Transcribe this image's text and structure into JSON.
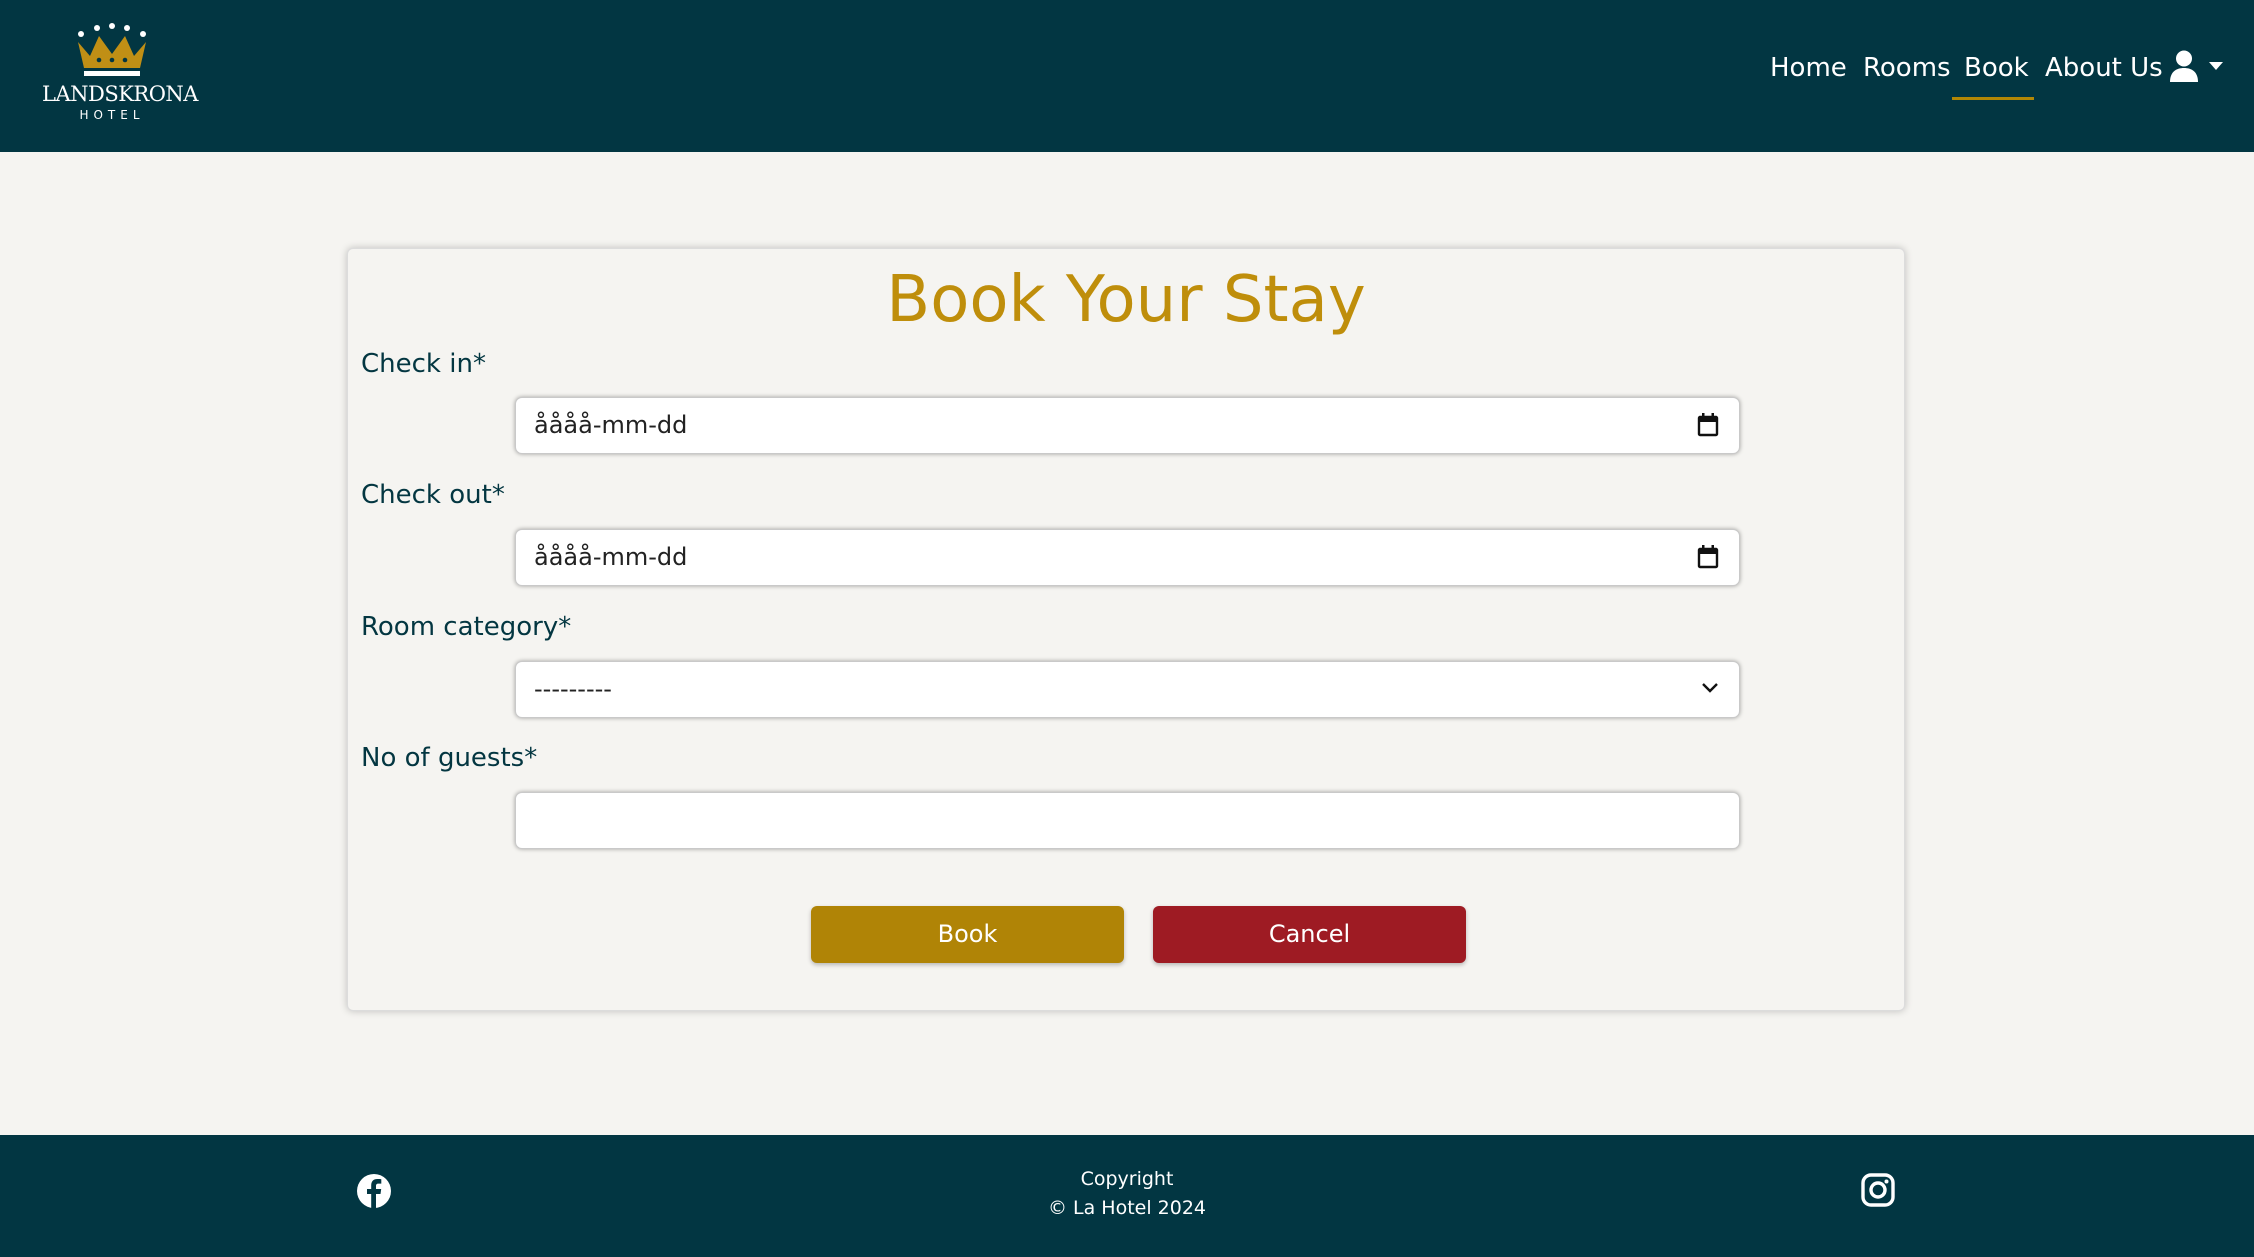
{
  "brand": {
    "name": "LANDSKRONA",
    "subtitle": "HOTEL",
    "logo_icon": "crown-icon",
    "accent_color": "#b28705"
  },
  "nav": {
    "items": [
      {
        "label": "Home",
        "active": false
      },
      {
        "label": "Rooms",
        "active": false
      },
      {
        "label": "Book",
        "active": true
      },
      {
        "label": "About Us",
        "active": false
      }
    ],
    "user_menu_icon": "user-icon"
  },
  "form": {
    "title": "Book Your Stay",
    "check_in": {
      "label": "Check in*",
      "value": "åååå-mm-dd"
    },
    "check_out": {
      "label": "Check out*",
      "value": "åååå-mm-dd"
    },
    "room_category": {
      "label": "Room category*",
      "selected": "---------"
    },
    "guests": {
      "label": "No of guests*",
      "value": ""
    },
    "book_label": "Book",
    "cancel_label": "Cancel",
    "book_color": "#b08406",
    "cancel_color": "#9e1b23"
  },
  "footer": {
    "copyright_line1": "Copyright",
    "copyright_line2": "© La Hotel 2024",
    "social": [
      "facebook-icon",
      "instagram-icon"
    ]
  }
}
